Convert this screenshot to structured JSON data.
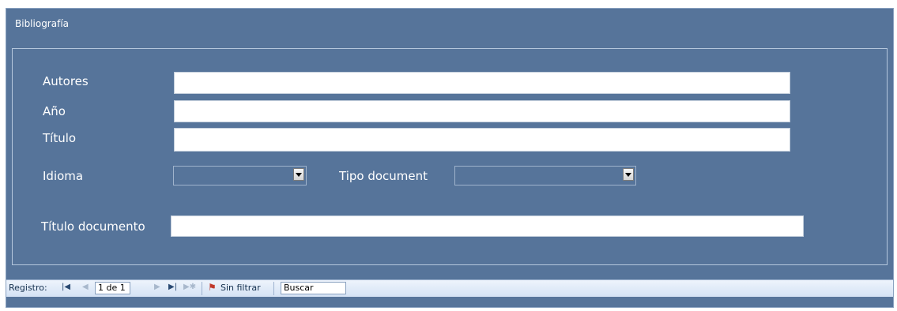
{
  "form": {
    "title": "Bibliografía"
  },
  "fields": {
    "autores": {
      "label": "Autores",
      "value": ""
    },
    "anio": {
      "label": "Año",
      "value": ""
    },
    "titulo": {
      "label": "Título",
      "value": ""
    },
    "idioma": {
      "label": "Idioma",
      "value": ""
    },
    "tipo_documento": {
      "label": "Tipo document",
      "value": ""
    },
    "titulo_documento": {
      "label": "Título documento",
      "value": ""
    }
  },
  "navigation": {
    "record_label": "Registro:",
    "record_value": "1 de 1",
    "filter_label": "Sin filtrar",
    "search_text": "Buscar",
    "first_icon": "first-record-icon",
    "prev_icon": "prev-record-icon",
    "next_icon": "next-record-icon",
    "last_icon": "last-record-icon",
    "new_icon": "new-record-icon",
    "filter_icon": "filter-off-icon"
  },
  "colors": {
    "form_background": "#56749a",
    "navbar_background": "#dbe6f5"
  }
}
